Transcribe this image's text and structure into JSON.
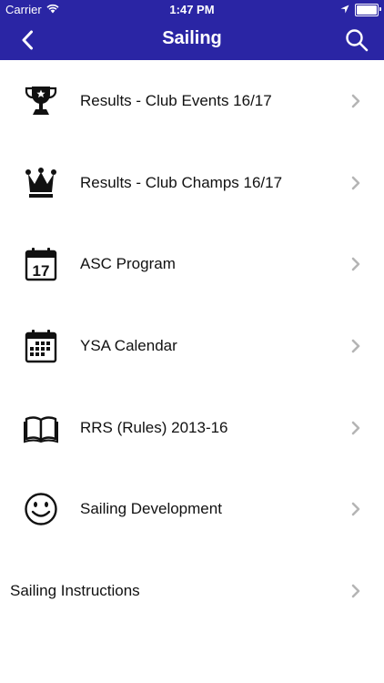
{
  "status_bar": {
    "carrier": "Carrier",
    "time": "1:47 PM"
  },
  "nav": {
    "title": "Sailing"
  },
  "items": [
    {
      "label": "Results - Club Events 16/17",
      "icon": "trophy-icon"
    },
    {
      "label": "Results - Club Champs 16/17",
      "icon": "crown-icon"
    },
    {
      "label": "ASC Program",
      "icon": "calendar-day-icon",
      "icon_text": "17"
    },
    {
      "label": "YSA Calendar",
      "icon": "calendar-grid-icon"
    },
    {
      "label": "RRS (Rules) 2013-16",
      "icon": "book-icon"
    },
    {
      "label": "Sailing Development",
      "icon": "smiley-icon"
    },
    {
      "label": "Sailing Instructions",
      "icon": null
    }
  ],
  "colors": {
    "header": "#2a25a4",
    "chevron": "#b5b5b5",
    "text": "#111111"
  }
}
